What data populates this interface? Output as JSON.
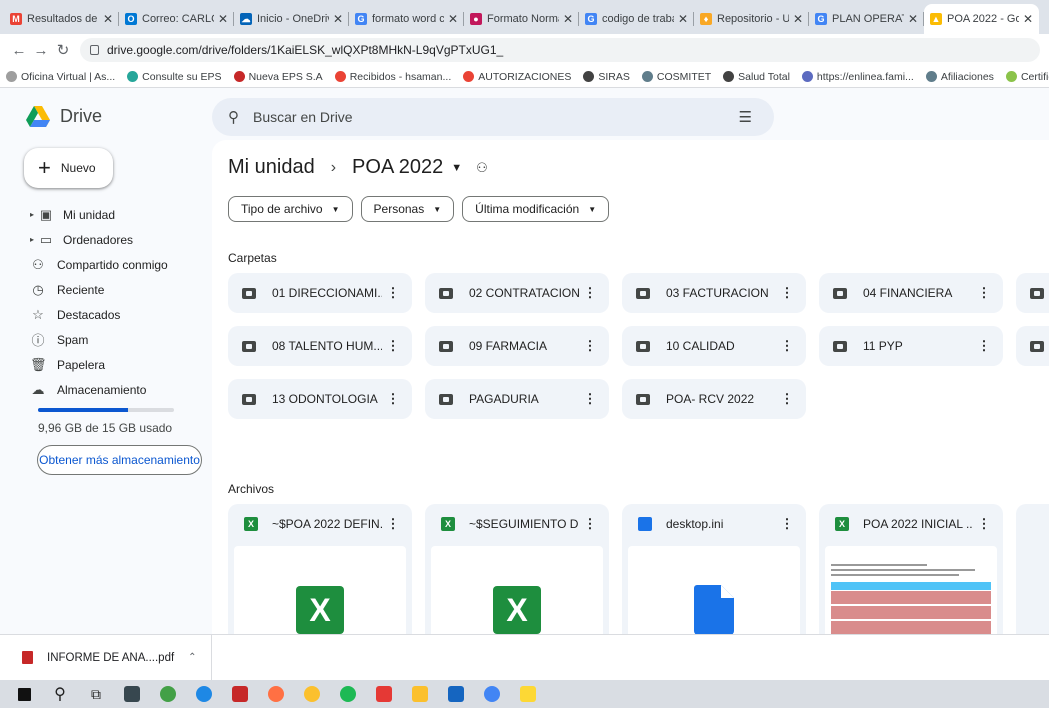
{
  "browser": {
    "tabs": [
      {
        "label": "Resultados de",
        "color": "#ea4335",
        "glyph": "M",
        "active": false
      },
      {
        "label": "Correo: CARLOS",
        "color": "#0078d4",
        "glyph": "O",
        "active": false
      },
      {
        "label": "Inicio - OneDriv",
        "color": "#0364b8",
        "glyph": "☁",
        "active": false
      },
      {
        "label": "formato word c",
        "color": "#4285f4",
        "glyph": "G",
        "active": false
      },
      {
        "label": "Formato Norma",
        "color": "#c2185b",
        "glyph": "●",
        "active": false
      },
      {
        "label": "codigo de traba",
        "color": "#4285f4",
        "glyph": "G",
        "active": false
      },
      {
        "label": "Repositorio - U",
        "color": "#f9a825",
        "glyph": "♦",
        "active": false
      },
      {
        "label": "PLAN OPERATI",
        "color": "#4285f4",
        "glyph": "G",
        "active": false
      },
      {
        "label": "POA 2022 - Go",
        "color": "#fbbc04",
        "glyph": "▲",
        "active": true
      }
    ],
    "url": "drive.google.com/drive/folders/1KaiELSK_wlQXPt8MHkN-L9qVgPTxUG1_",
    "bookmarks": [
      {
        "label": "Oficina Virtual | As...",
        "color": "#9e9e9e"
      },
      {
        "label": "Consulte su EPS",
        "color": "#26a69a"
      },
      {
        "label": "Nueva EPS S.A",
        "color": "#c62828"
      },
      {
        "label": "Recibidos - hsaman...",
        "color": "#ea4335"
      },
      {
        "label": "AUTORIZACIONES",
        "color": "#ea4335"
      },
      {
        "label": "SIRAS",
        "color": "#424242"
      },
      {
        "label": "COSMITET",
        "color": "#607d8b"
      },
      {
        "label": "Salud Total",
        "color": "#424242"
      },
      {
        "label": "https://enlinea.fami...",
        "color": "#5c6bc0"
      },
      {
        "label": "Afiliaciones",
        "color": "#607d8b"
      },
      {
        "label": "Certificados",
        "color": "#8bc34a"
      }
    ]
  },
  "drive": {
    "logo": "Drive",
    "search_placeholder": "Buscar en Drive",
    "new_label": "Nuevo",
    "nav": [
      {
        "label": "Mi unidad",
        "icon": "drive-icon",
        "glyph": "▣",
        "caret": true
      },
      {
        "label": "Ordenadores",
        "icon": "computer-icon",
        "glyph": "▭",
        "caret": true
      },
      {
        "label": "Compartido conmigo",
        "icon": "people-icon",
        "glyph": "⚇",
        "caret": false
      },
      {
        "label": "Reciente",
        "icon": "clock-icon",
        "glyph": "◷",
        "caret": false
      },
      {
        "label": "Destacados",
        "icon": "star-icon",
        "glyph": "☆",
        "caret": false
      },
      {
        "label": "Spam",
        "icon": "spam-icon",
        "glyph": "ⓘ",
        "caret": false
      },
      {
        "label": "Papelera",
        "icon": "trash-icon",
        "glyph": "🗑",
        "caret": false
      },
      {
        "label": "Almacenamiento",
        "icon": "cloud-icon",
        "glyph": "☁",
        "caret": false
      }
    ],
    "storage_text": "9,96 GB de 15 GB usado",
    "storage_fraction": 0.664,
    "get_more_label": "Obtener más almacenamiento",
    "breadcrumb": {
      "root": "Mi unidad",
      "current": "POA 2022"
    },
    "filters": [
      "Tipo de archivo",
      "Personas",
      "Última modificación"
    ],
    "folders_title": "Carpetas",
    "folders": [
      [
        "01 DIRECCIONAMI...",
        "02 CONTRATACION",
        "03 FACTURACION",
        "04 FINANCIERA"
      ],
      [
        "08 TALENTO HUM...",
        "09 FARMACIA",
        "10 CALIDAD",
        "11 PYP"
      ],
      [
        "13 ODONTOLOGIA",
        "PAGADURIA",
        "POA- RCV 2022"
      ]
    ],
    "files_title": "Archivos",
    "files": [
      {
        "name": "~$POA 2022 DEFIN...",
        "type": "excel"
      },
      {
        "name": "~$SEGUIMIENTO D...",
        "type": "excel"
      },
      {
        "name": "desktop.ini",
        "type": "doc"
      },
      {
        "name": "POA 2022 INICIAL ...",
        "type": "sheet"
      }
    ]
  },
  "download": {
    "name": "INFORME DE ANA....pdf"
  }
}
